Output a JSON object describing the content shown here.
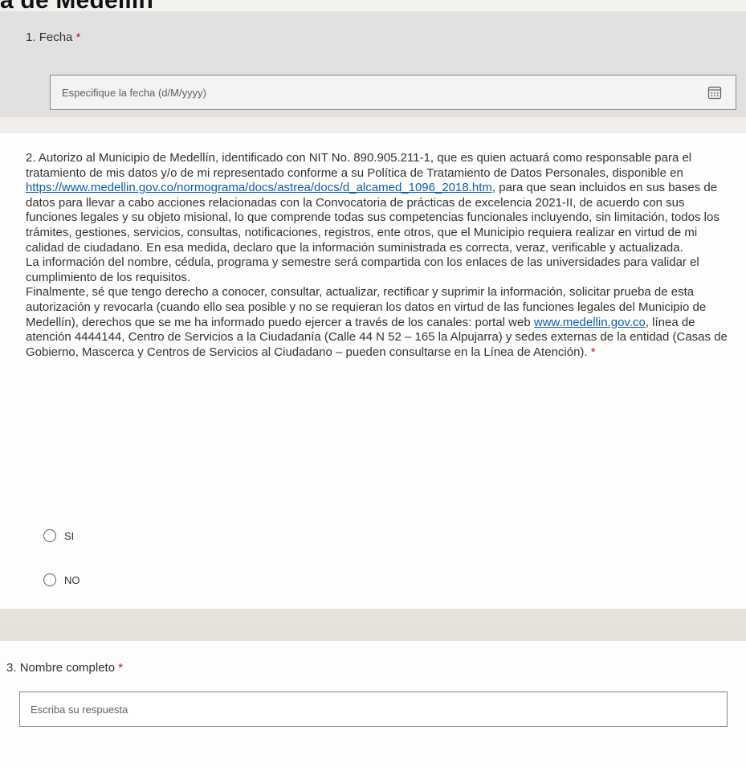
{
  "page": {
    "title_fragment": "a de Medellín"
  },
  "q1": {
    "number": "1.",
    "label": "Fecha",
    "required": "*",
    "placeholder": "Especifique la fecha (d/M/yyyy)",
    "icon": "calendar-icon"
  },
  "q2": {
    "number": "2.",
    "para1_before_link": "Autorizo al Municipio de Medellín, identificado con NIT No. 890.905.211-1, que es quien actuará como responsable para el tratamiento de mis datos y/o de mi representado conforme a su Política de Tratamiento de Datos Personales, disponible en ",
    "policy_link": "https://www.medellin.gov.co/normograma/docs/astrea/docs/d_alcamed_1096_2018.htm",
    "para1_after_link": ", para que sean incluidos en sus bases de datos para llevar a cabo acciones relacionadas con la Convocatoria de prácticas de excelencia 2021-II, de acuerdo con sus funciones legales y su objeto misional, lo que comprende todas sus competencias funcionales incluyendo, sin limitación, todos los trámites, gestiones, servicios, consultas, notificaciones, registros, ente otros, que el Municipio requiera realizar en virtud de mi calidad de ciudadano. En esa medida, declaro que la información suministrada es correcta, veraz, verificable y actualizada.",
    "para2": "La información del nombre, cédula, programa y semestre será compartida con los enlaces de las universidades para validar el cumplimiento de los requisitos.",
    "para3_before_link": "Finalmente, sé que tengo derecho a conocer, consultar, actualizar, rectificar y suprimir la información, solicitar prueba de esta autorización y revocarla (cuando ello sea posible y no se requieran los datos en virtud de las funciones legales del Municipio de Medellín), derechos que se me ha informado puedo ejercer a través de los canales: portal web ",
    "web_link": "www.medellin.gov.co",
    "para3_after_link": ", línea de atención 4444144, Centro de Servicios a la Ciudadanía (Calle 44 N 52 – 165 la Alpujarra) y sedes externas de la entidad (Casas de Gobierno, Mascerca y Centros de Servicios al Ciudadano – pueden consultarse en la Línea de Atención).",
    "required": "*",
    "options": [
      "SI",
      "NO"
    ]
  },
  "q3": {
    "number": "3.",
    "label": "Nombre completo",
    "required": "*",
    "placeholder": "Escriba su respuesta"
  },
  "colors": {
    "required": "#a4262c",
    "link": "#0b5ea8",
    "text": "#323130",
    "field_border": "#8a8886"
  }
}
